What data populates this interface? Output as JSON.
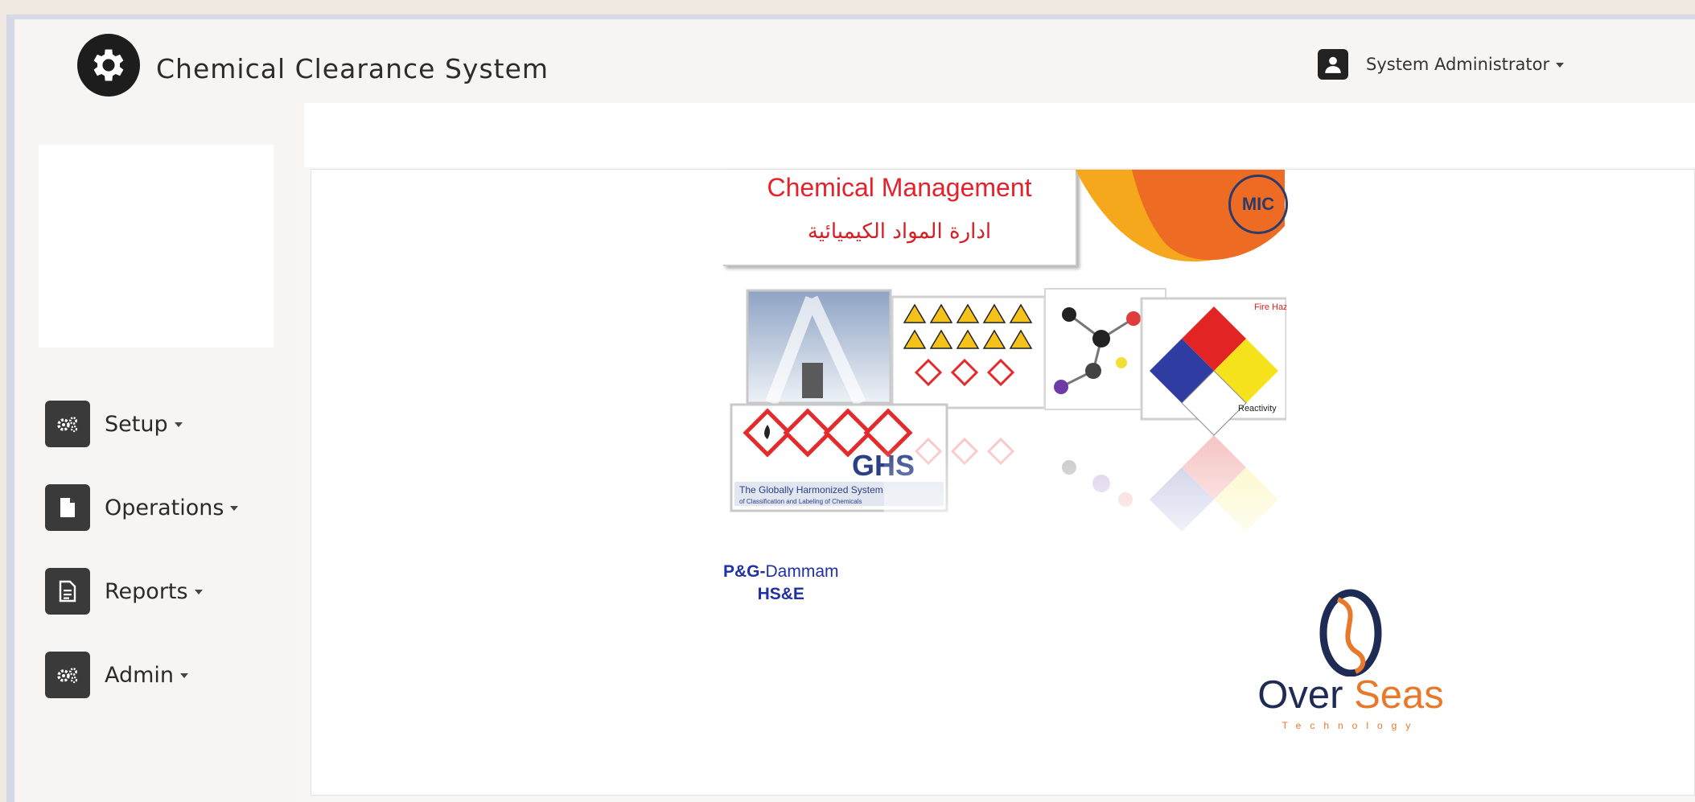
{
  "app": {
    "title": "Chemical Clearance System",
    "brand_icon": "gear-icon"
  },
  "user_menu": {
    "name": "System Administrator",
    "icon": "user-icon"
  },
  "sidebar": {
    "items": [
      {
        "label": "Setup",
        "icon": "cogs-icon"
      },
      {
        "label": "Operations",
        "icon": "file-icon"
      },
      {
        "label": "Reports",
        "icon": "report-icon"
      },
      {
        "label": "Admin",
        "icon": "cogs-icon"
      }
    ]
  },
  "banner": {
    "title": "Chemical Management",
    "arabic_title": "ادارة المواد الكيميائية",
    "mic_badge": "MIC",
    "ghs_label": "GHS",
    "ghs_caption": "The Globally Harmonized System",
    "ghs_subcaption": "of Classification and Labeling of Chemicals",
    "nfpa_fire": "Fire Hazard",
    "nfpa_reactivity": "Reactivity",
    "site_prefix": "P&G-",
    "site_name": "Dammam",
    "site_dept": "HS&E"
  },
  "overseas": {
    "word1": "Over",
    "word2": "Seas",
    "tagline": "Technology"
  },
  "colors": {
    "accent_red": "#e3222b",
    "overseas_navy": "#1e2b55",
    "overseas_orange": "#e8782a"
  }
}
